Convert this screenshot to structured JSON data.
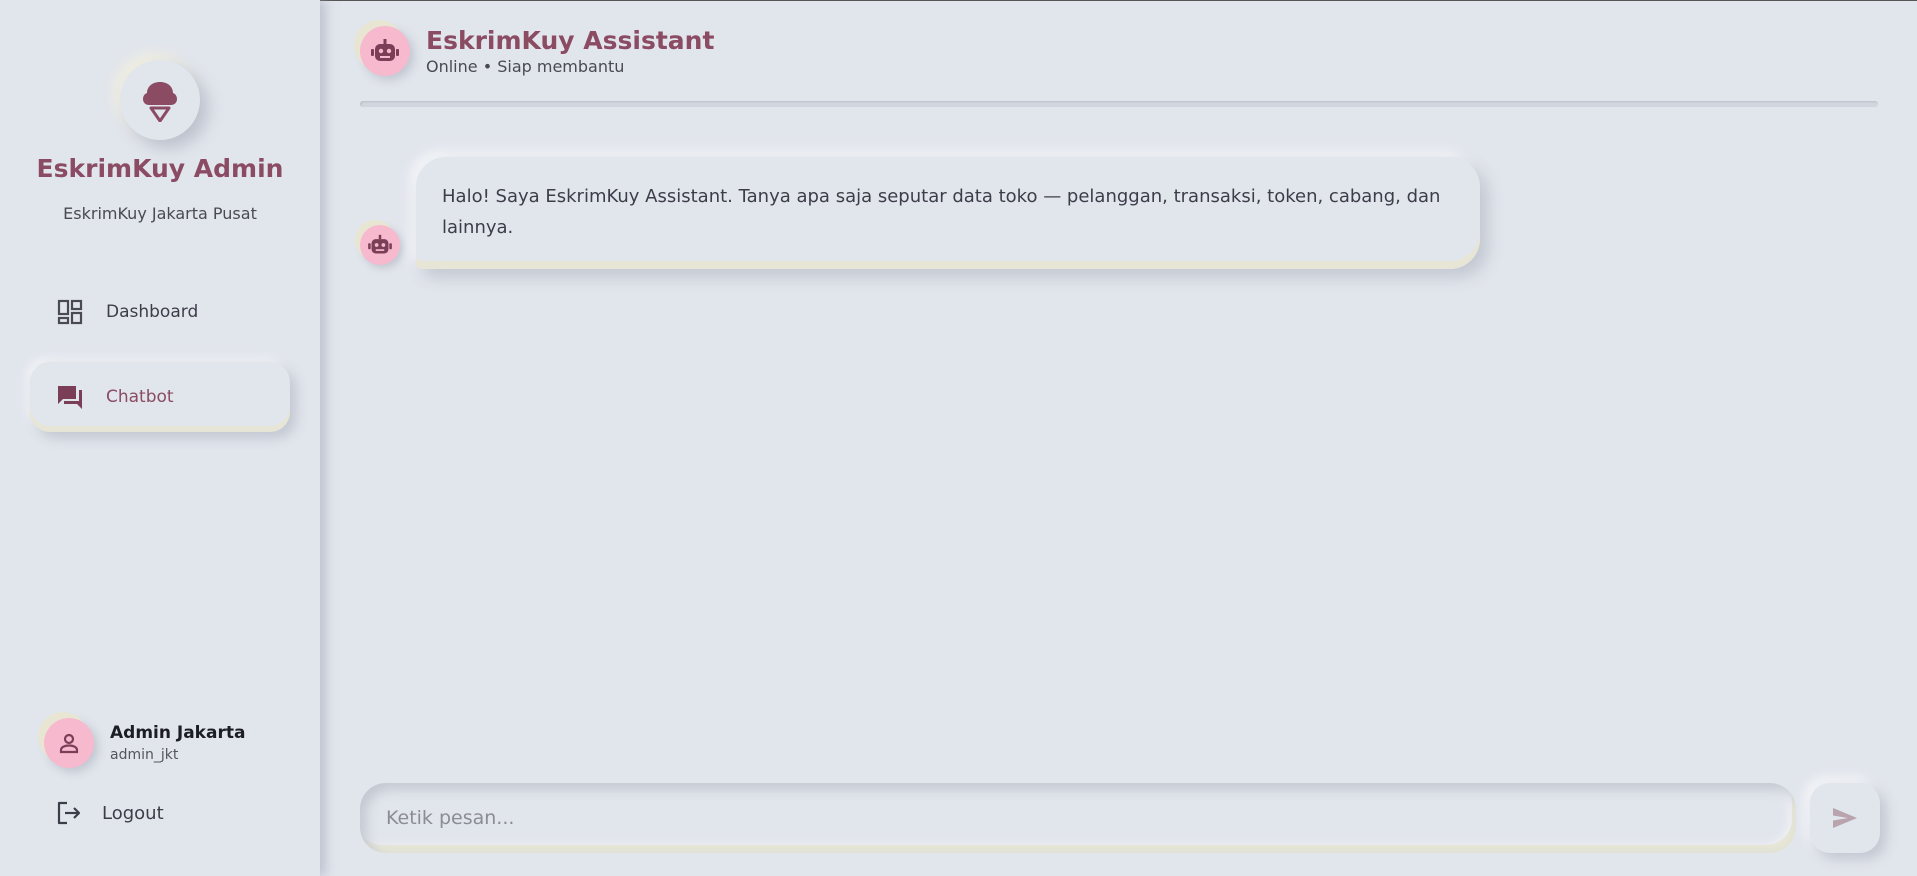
{
  "sidebar": {
    "brand_title": "EskrimKuy Admin",
    "brand_subtitle": "EskrimKuy Jakarta Pusat",
    "nav": [
      {
        "label": "Dashboard",
        "icon": "dashboard-icon",
        "active": false
      },
      {
        "label": "Chatbot",
        "icon": "chat-icon",
        "active": true
      }
    ],
    "user": {
      "name": "Admin Jakarta",
      "handle": "admin_jkt"
    },
    "logout_label": "Logout"
  },
  "chat": {
    "title": "EskrimKuy Assistant",
    "status": "Online • Siap membantu",
    "messages": [
      {
        "sender": "bot",
        "text": "Halo! Saya EskrimKuy Assistant. Tanya apa saja seputar data toko — pelanggan, transaksi, token, cabang, dan lainnya."
      }
    ],
    "input_placeholder": "Ketik pesan..."
  },
  "colors": {
    "background": "#e1e5ec",
    "accent": "#8a4b63",
    "avatar_pink": "#f7b9ce",
    "send_icon": "#b9a3ad"
  }
}
